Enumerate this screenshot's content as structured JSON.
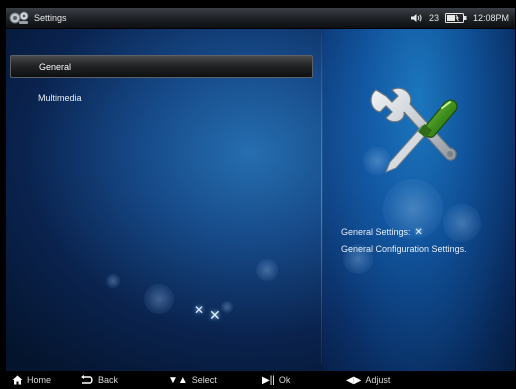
{
  "status_bar": {
    "title": "Settings",
    "volume_level": "23",
    "time": "12:08PM",
    "icons": {
      "app": "settings-gear-icon",
      "volume": "speaker-icon",
      "battery": "battery-icon"
    }
  },
  "menu": {
    "items": [
      {
        "label": "General",
        "selected": true
      },
      {
        "label": "Multimedia",
        "selected": false
      }
    ]
  },
  "detail": {
    "icon": "wrench-screwdriver-icon",
    "heading": "General Settings:",
    "description": "General Configuration Settings."
  },
  "footer": {
    "home_label": "Home",
    "back_label": "Back",
    "select_label": "Select",
    "ok_label": "Ok",
    "adjust_label": "Adjust"
  },
  "colors": {
    "screen_background": "#0b2550",
    "selected_bar": "#232425",
    "wrench": "#c9ced4",
    "screwdriver_handle": "#3f8f1d"
  }
}
